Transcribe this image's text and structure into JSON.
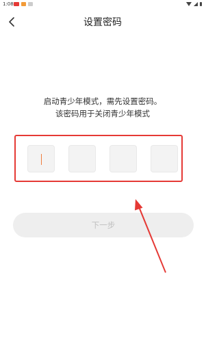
{
  "status_bar": {
    "time": "1:08"
  },
  "header": {
    "title": "设置密码",
    "back_icon": "chevron-left-icon"
  },
  "instructions": {
    "line1": "启动青少年模式，需先设置密码。",
    "line2": "该密码用于关闭青少年模式"
  },
  "code_input": {
    "digits": [
      "",
      "",
      "",
      ""
    ],
    "active_index": 0,
    "caret_color": "#f07c3c"
  },
  "next_button": {
    "label": "下一步",
    "enabled": false
  },
  "annotation": {
    "color": "#e53935"
  }
}
